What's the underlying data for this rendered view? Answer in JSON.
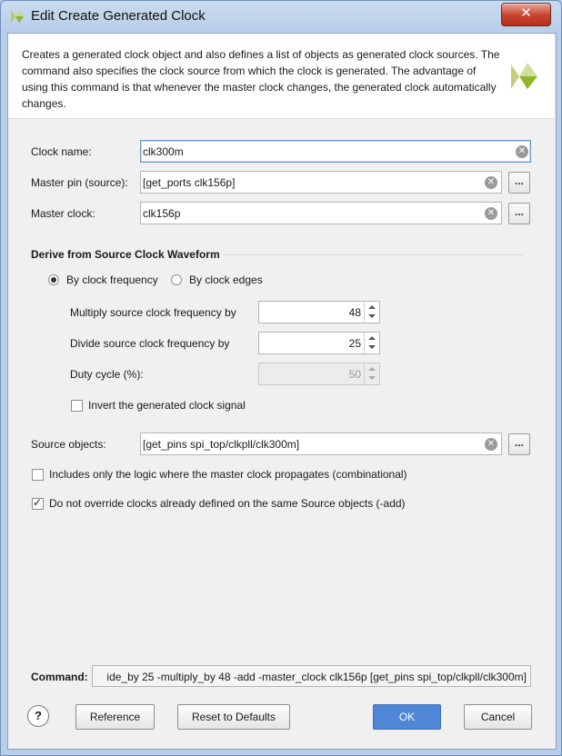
{
  "window": {
    "title": "Edit Create Generated Clock",
    "close_glyph": "✕"
  },
  "description": "Creates a generated clock object and also defines a list of objects as generated clock sources. The command also specifies the clock source from which the clock is generated. The advantage of using this command is that whenever the master clock changes, the generated clock automatically changes.",
  "fields": {
    "clock_name": {
      "label": "Clock name:",
      "value": "clk300m"
    },
    "master_pin": {
      "label": "Master pin (source):",
      "value": "[get_ports clk156p]"
    },
    "master_clock": {
      "label": "Master clock:",
      "value": "clk156p"
    },
    "source_objects": {
      "label": "Source objects:",
      "value": "[get_pins spi_top/clkpll/clk300m]"
    },
    "browse_label": "...",
    "clear_glyph": "✕"
  },
  "waveform": {
    "section_title": "Derive from Source Clock Waveform",
    "radio_frequency": "By clock frequency",
    "radio_edges": "By clock edges",
    "selected": "frequency",
    "multiply": {
      "label": "Multiply source clock frequency by",
      "value": "48"
    },
    "divide": {
      "label": "Divide source clock frequency by",
      "value": "25"
    },
    "duty": {
      "label": "Duty cycle (%):",
      "value": "50",
      "disabled": true
    },
    "invert": {
      "label": "Invert the generated clock signal",
      "checked": false
    }
  },
  "options": {
    "combinational": {
      "label": "Includes only the logic where the master clock propagates (combinational)",
      "checked": false
    },
    "add": {
      "label": "Do not override clocks already defined on the same Source objects (-add)",
      "checked": true
    }
  },
  "command": {
    "label": "Command:",
    "value": "ide_by 25 -multiply_by 48 -add -master_clock clk156p [get_pins spi_top/clkpll/clk300m]"
  },
  "buttons": {
    "help": "?",
    "reference": "Reference",
    "reset": "Reset to Defaults",
    "ok": "OK",
    "cancel": "Cancel"
  },
  "colors": {
    "accent": "#4f86d6",
    "logo": "#8fb52a"
  }
}
